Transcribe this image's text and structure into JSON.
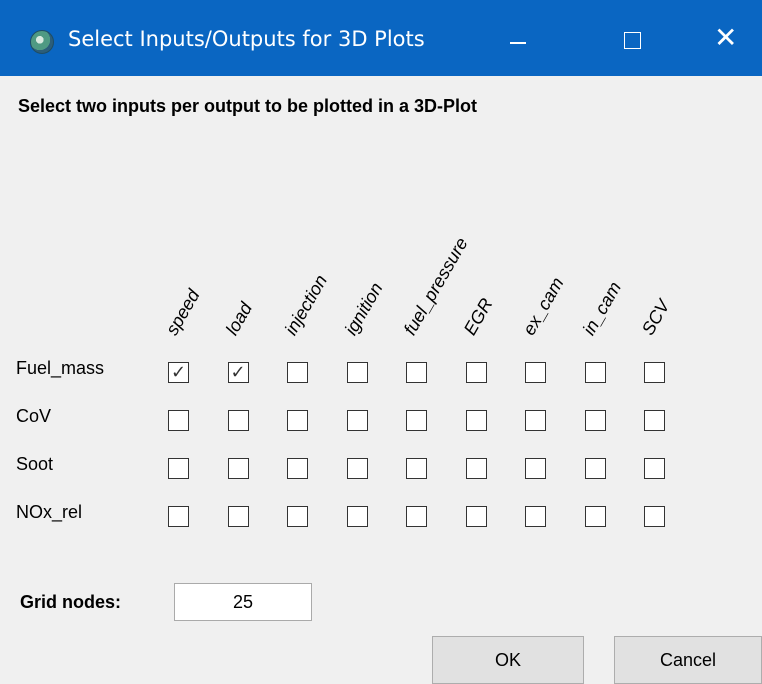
{
  "window": {
    "title": "Select Inputs/Outputs for 3D Plots",
    "icon": "app-icon",
    "controls": {
      "minimize": "—",
      "maximize": "☐",
      "close": "✕"
    }
  },
  "heading": "Select two inputs per output to be plotted in a 3D-Plot",
  "inputs": [
    "speed",
    "load",
    "injection",
    "ignition",
    "fuel_pressure",
    "EGR",
    "ex_cam",
    "in_cam",
    "SCV"
  ],
  "outputs": [
    "Fuel_mass",
    "CoV",
    "Soot",
    "NOx_rel"
  ],
  "selection": [
    [
      true,
      true,
      false,
      false,
      false,
      false,
      false,
      false,
      false
    ],
    [
      false,
      false,
      false,
      false,
      false,
      false,
      false,
      false,
      false
    ],
    [
      false,
      false,
      false,
      false,
      false,
      false,
      false,
      false,
      false
    ],
    [
      false,
      false,
      false,
      false,
      false,
      false,
      false,
      false,
      false
    ]
  ],
  "grid_nodes": {
    "label": "Grid nodes:",
    "value": "25"
  },
  "buttons": {
    "ok": "OK",
    "cancel": "Cancel"
  },
  "colors": {
    "titlebar": "#0a66c2",
    "background": "#f0f0f0"
  }
}
